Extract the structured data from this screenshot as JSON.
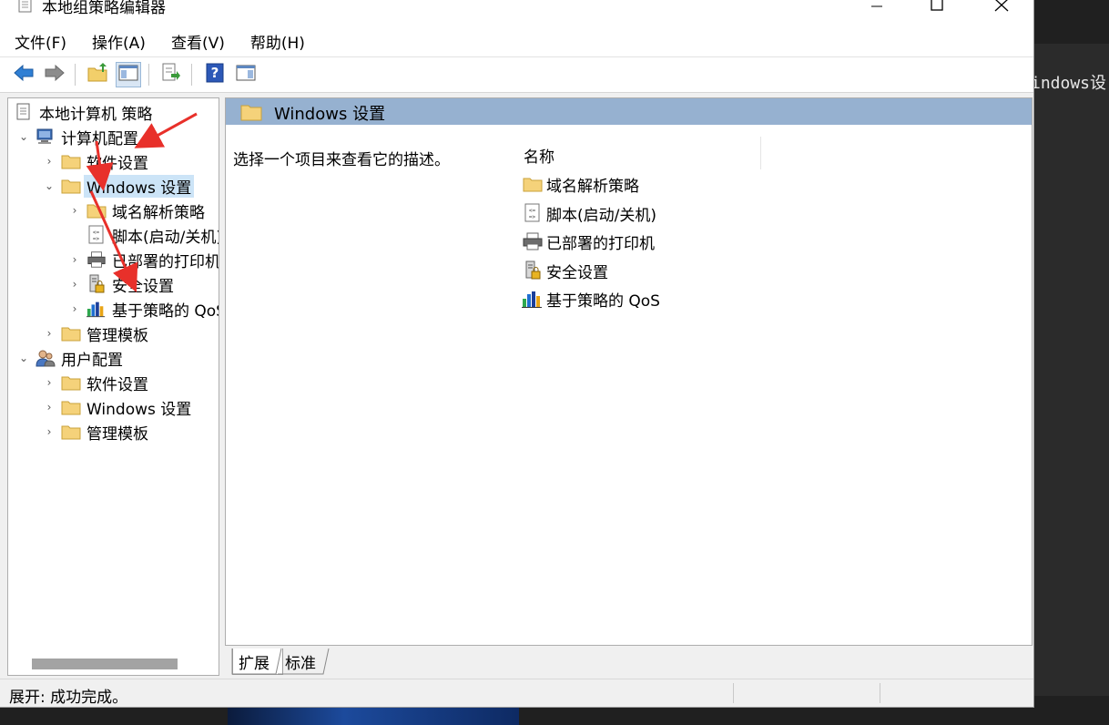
{
  "window": {
    "title": "本地组策略编辑器",
    "menu": [
      "文件(F)",
      "操作(A)",
      "查看(V)",
      "帮助(H)"
    ]
  },
  "toolbar": {
    "buttons": [
      "back-icon",
      "forward-icon",
      "up-folder-icon",
      "show-hide-tree-icon",
      "export-list-icon",
      "help-icon",
      "properties-pane-icon"
    ]
  },
  "tree": {
    "root": "本地计算机 策略",
    "computer_config": "计算机配置",
    "computer_children": {
      "software": "软件设置",
      "windows": "Windows 设置",
      "windows_children": [
        "域名解析策略",
        "脚本(启动/关机)",
        "已部署的打印机",
        "安全设置",
        "基于策略的 QoS"
      ],
      "admin_templates": "管理模板"
    },
    "user_config": "用户配置",
    "user_children": [
      "软件设置",
      "Windows 设置",
      "管理模板"
    ]
  },
  "right_pane": {
    "header": "Windows 设置",
    "description": "选择一个项目来查看它的描述。",
    "column_name": "名称",
    "items": [
      "域名解析策略",
      "脚本(启动/关机)",
      "已部署的打印机",
      "安全设置",
      "基于策略的 QoS"
    ]
  },
  "tabs": [
    "扩展",
    "标准"
  ],
  "status": "展开: 成功完成。",
  "background": {
    "text": "indows设"
  },
  "colors": {
    "header_band": "#96b1d0",
    "selection": "#cce4f7",
    "annotation_arrow": "#e8302a"
  }
}
